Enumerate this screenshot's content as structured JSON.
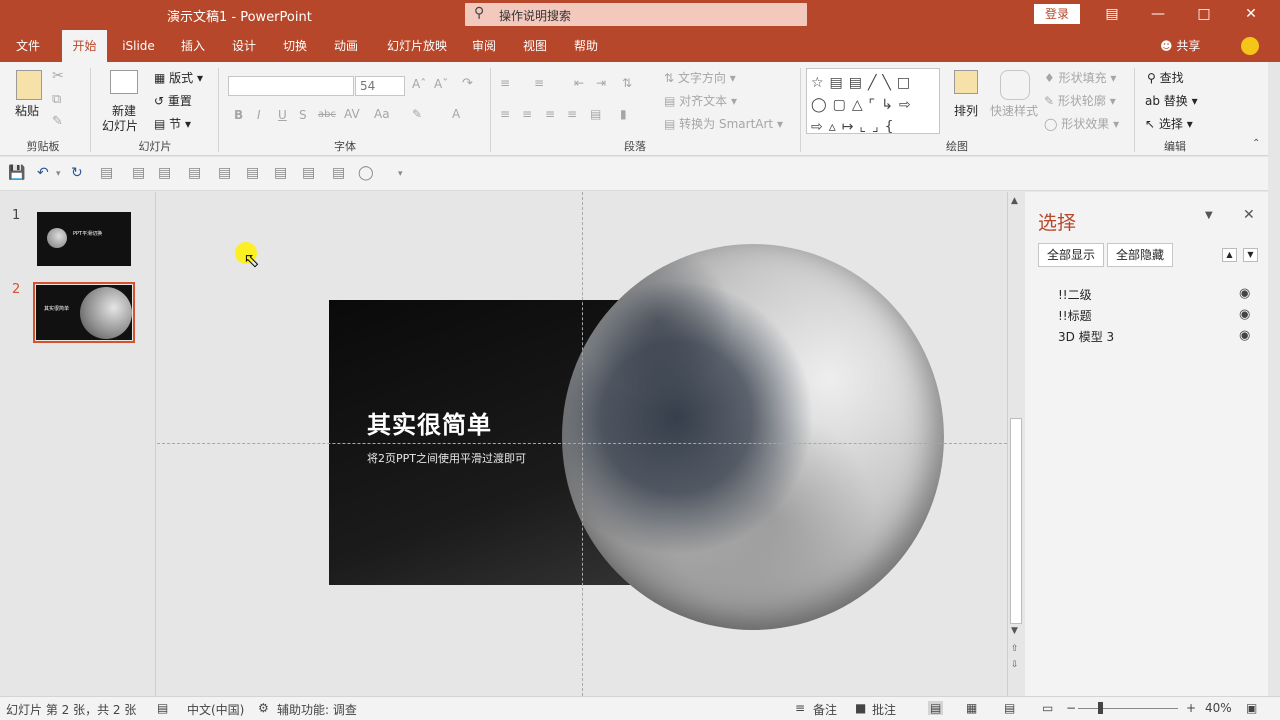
{
  "app": {
    "title": "演示文稿1  -  PowerPoint",
    "tell_me": "操作说明搜索",
    "login": "登录"
  },
  "tabs": [
    "文件",
    "开始",
    "iSlide",
    "插入",
    "设计",
    "切换",
    "动画",
    "幻灯片放映",
    "审阅",
    "视图",
    "帮助"
  ],
  "share": "共享",
  "ribbon": {
    "clipboard": {
      "paste": "粘贴",
      "label": "剪贴板"
    },
    "slides": {
      "new_slide": "新建",
      "new_slide2": "幻灯片",
      "layout": "版式",
      "reset": "重置",
      "section": "节",
      "label": "幻灯片"
    },
    "font": {
      "size": "54",
      "label": "字体"
    },
    "paragraph": {
      "text_dir": "文字方向",
      "align_text": "对齐文本",
      "smartart": "转换为 SmartArt",
      "label": "段落"
    },
    "drawing": {
      "arrange": "排列",
      "quick_styles": "快速样式",
      "fill": "形状填充",
      "outline": "形状轮廓",
      "effects": "形状效果",
      "label": "绘图"
    },
    "editing": {
      "find": "查找",
      "replace": "替换",
      "select": "选择",
      "label": "编辑"
    }
  },
  "thumbnails": [
    {
      "num": "1",
      "text": "PPT平滑切换"
    },
    {
      "num": "2",
      "text": "其实很简单"
    }
  ],
  "slide": {
    "title": "其实很简单",
    "subtitle": "将2页PPT之间使用平滑过渡即可"
  },
  "selection_pane": {
    "title": "选择",
    "show_all": "全部显示",
    "hide_all": "全部隐藏",
    "items": [
      "!!二级",
      "!!标题",
      "3D 模型 3"
    ]
  },
  "status": {
    "slide_info": "幻灯片 第 2 张，共 2 张",
    "language": "中文(中国)",
    "accessibility": "辅助功能: 调查",
    "notes": "备注",
    "comments": "批注",
    "zoom": "40%"
  },
  "colors": {
    "accent": "#b7472a",
    "selection": "#d35230"
  }
}
